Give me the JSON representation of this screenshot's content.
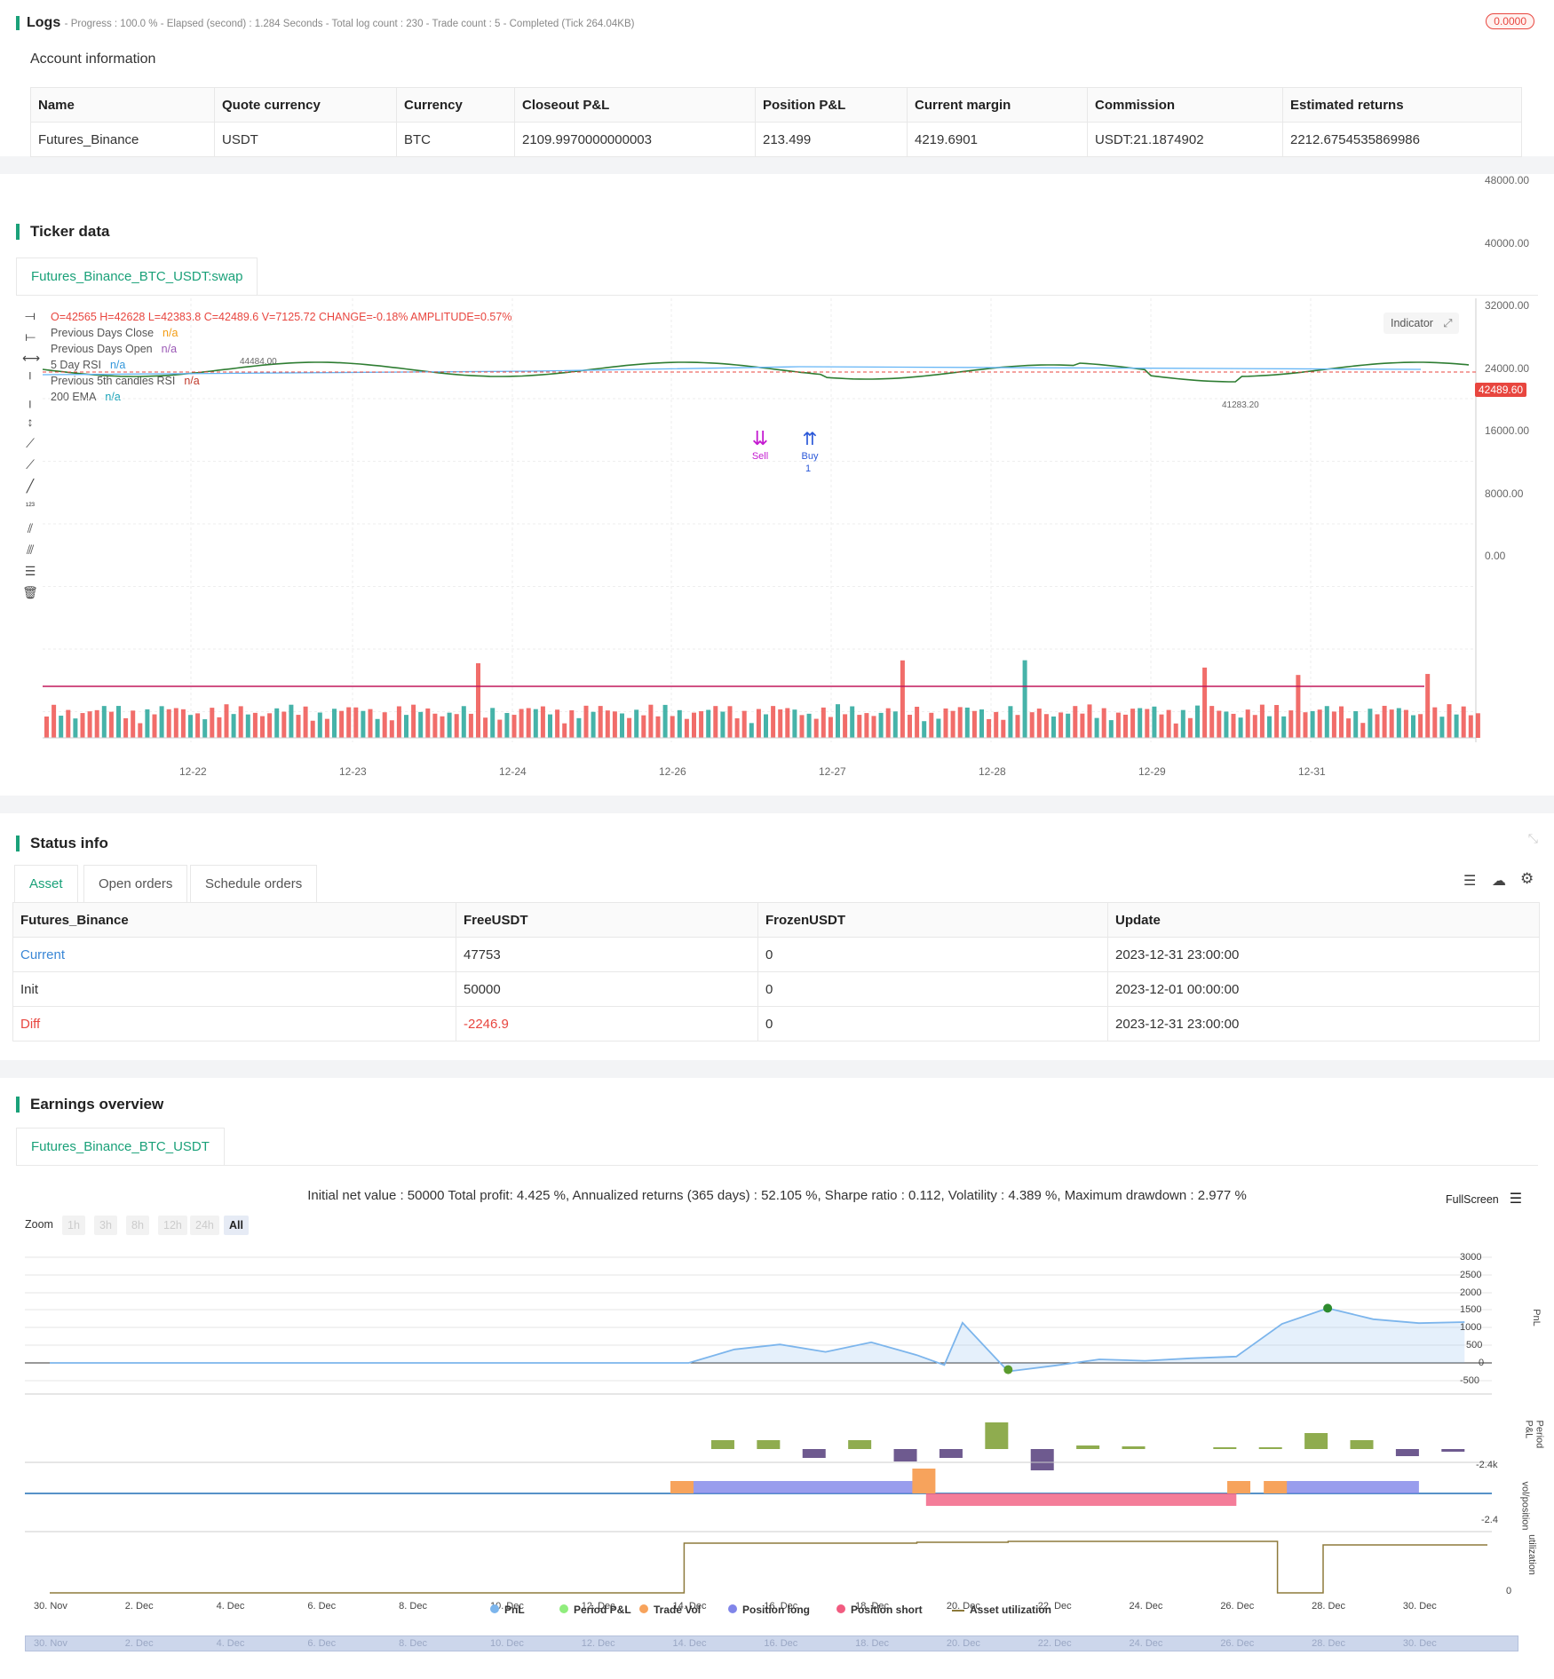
{
  "logs": {
    "title": "Logs",
    "summary": "- Progress : 100.0 % - Elapsed (second) : 1.284 Seconds - Total log count : 230 - Trade count : 5 - Completed (Tick 264.04KB)",
    "badge": "0.0000",
    "badge_color": "#e8463f"
  },
  "account": {
    "title": "Account information",
    "columns": [
      "Name",
      "Quote currency",
      "Currency",
      "Closeout P&L",
      "Position P&L",
      "Current margin",
      "Commission",
      "Estimated returns"
    ],
    "row": [
      "Futures_Binance",
      "USDT",
      "BTC",
      "2109.9970000000003",
      "213.499",
      "4219.6901",
      "USDT:21.1874902",
      "2212.6754535869986"
    ]
  },
  "ticker": {
    "title": "Ticker data",
    "tab": "Futures_Binance_BTC_USDT:swap",
    "ohlc": "O=42565 H=42628 L=42383.8 C=42489.6 V=7125.72 CHANGE=-0.18% AMPLITUDE=0.57%",
    "legend": [
      {
        "label": "Previous Days Close",
        "value": "n/a",
        "color": "#f39c12"
      },
      {
        "label": "Previous Days Open",
        "value": "n/a",
        "color": "#9b59b6"
      },
      {
        "label": "5 Day RSI",
        "value": "n/a",
        "color": "#3498db"
      },
      {
        "label": "Previous 5th candles RSI",
        "value": "n/a",
        "color": "#c0392b"
      },
      {
        "label": "200 EMA",
        "value": "n/a",
        "color": "#17a2b8"
      }
    ],
    "indicator_btn": "Indicator",
    "price_labels": [
      "48000.00",
      "40000.00",
      "32000.00",
      "24000.00",
      "16000.00",
      "8000.00",
      "0.00"
    ],
    "current_price": "42489.60",
    "high_marker": "44484.00",
    "low_marker": "41283.20",
    "x_labels": [
      "12-22",
      "12-23",
      "12-24",
      "12-26",
      "12-27",
      "12-28",
      "12-29",
      "12-31"
    ],
    "markers": [
      {
        "text": "Sell",
        "color": "#c41bd1"
      },
      {
        "text": "Buy",
        "color": "#2957d8"
      }
    ],
    "marker_extra": [
      "1",
      "1"
    ],
    "colors": {
      "up": "#26a69a",
      "down": "#ef5350"
    }
  },
  "status": {
    "title": "Status info",
    "tabs": [
      "Asset",
      "Open orders",
      "Schedule orders"
    ],
    "columns": [
      "Futures_Binance",
      "FreeUSDT",
      "FrozenUSDT",
      "Update"
    ],
    "rows": [
      {
        "name": "Current",
        "free": "47753",
        "frozen": "0",
        "update": "2023-12-31 23:00:00"
      },
      {
        "name": "Init",
        "free": "50000",
        "frozen": "0",
        "update": "2023-12-01 00:00:00"
      },
      {
        "name": "Diff",
        "free": "-2246.9",
        "frozen": "0",
        "update": "2023-12-31 23:00:00"
      }
    ]
  },
  "earnings": {
    "title": "Earnings overview",
    "tab": "Futures_Binance_BTC_USDT",
    "summary": "Initial net value : 50000 Total profit: 4.425 %, Annualized returns (365 days) : 52.105 %, Sharpe ratio : 0.112, Volatility : 4.389 %, Maximum drawdown : 2.977 %",
    "fullscreen": "FullScreen",
    "zoom_label": "Zoom",
    "zoom_buttons": [
      "1h",
      "3h",
      "8h",
      "12h",
      "24h",
      "All"
    ],
    "pnl_ticks": [
      "3000",
      "2500",
      "2000",
      "1500",
      "1000",
      "500",
      "0",
      "-500"
    ],
    "axis_titles": [
      "PnL",
      "Period P&L",
      "vol/position",
      "utilization"
    ],
    "period_min": "-2.4k",
    "vol_min": "-2.4",
    "util_zero": "0",
    "x_labels": [
      "30. Nov",
      "2. Dec",
      "4. Dec",
      "6. Dec",
      "8. Dec",
      "10. Dec",
      "12. Dec",
      "14. Dec",
      "16. Dec",
      "18. Dec",
      "20. Dec",
      "22. Dec",
      "24. Dec",
      "26. Dec",
      "28. Dec",
      "30. Dec"
    ],
    "legend": [
      {
        "label": "PnL",
        "color": "#7cb5ec"
      },
      {
        "label": "Period P&L",
        "color": "#90ed7d"
      },
      {
        "label": "Trade Vol",
        "color": "#f7a35c"
      },
      {
        "label": "Position long",
        "color": "#8085e9"
      },
      {
        "label": "Position short",
        "color": "#f15c80"
      },
      {
        "label": "Asset utilization",
        "color": "#8d7a3c"
      }
    ]
  }
}
